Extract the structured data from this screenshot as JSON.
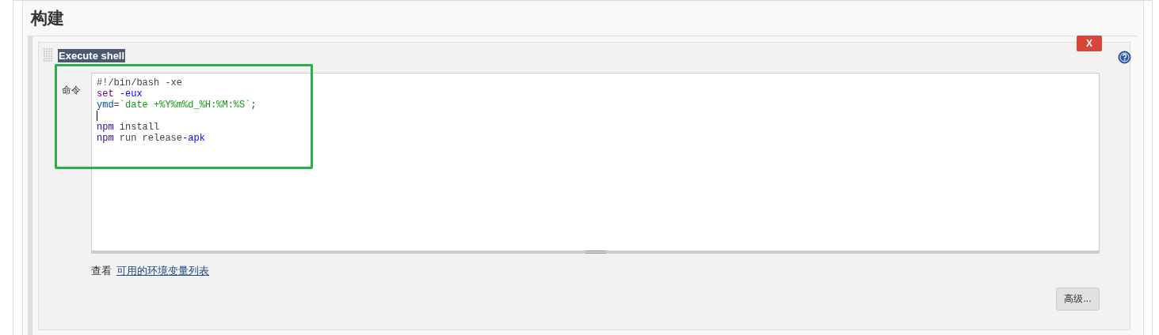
{
  "section": {
    "title": "构建"
  },
  "build_step": {
    "title": "Execute shell",
    "title_selected": true,
    "delete_label": "X",
    "field_label": "命令",
    "code_lines": [
      [
        {
          "kind": "plain",
          "text": "#!/bin/bash -xe"
        }
      ],
      [
        {
          "kind": "keyword",
          "text": "set "
        },
        {
          "kind": "option",
          "text": "-eux"
        }
      ],
      [
        {
          "kind": "variable",
          "text": "ymd"
        },
        {
          "kind": "plain",
          "text": "="
        },
        {
          "kind": "string",
          "text": "`date +%Y%m%d_%H:%M:%S`"
        },
        {
          "kind": "plain",
          "text": ";"
        }
      ],
      [
        {
          "kind": "cursor"
        }
      ],
      [
        {
          "kind": "command",
          "text": "npm"
        },
        {
          "kind": "plain",
          "text": " install"
        }
      ],
      [
        {
          "kind": "command",
          "text": "npm"
        },
        {
          "kind": "plain",
          "text": " run release"
        },
        {
          "kind": "option",
          "text": "-apk"
        }
      ]
    ],
    "hint_prefix": "查看",
    "hint_link": "可用的环境变量列表",
    "advanced_button": "高级..."
  }
}
